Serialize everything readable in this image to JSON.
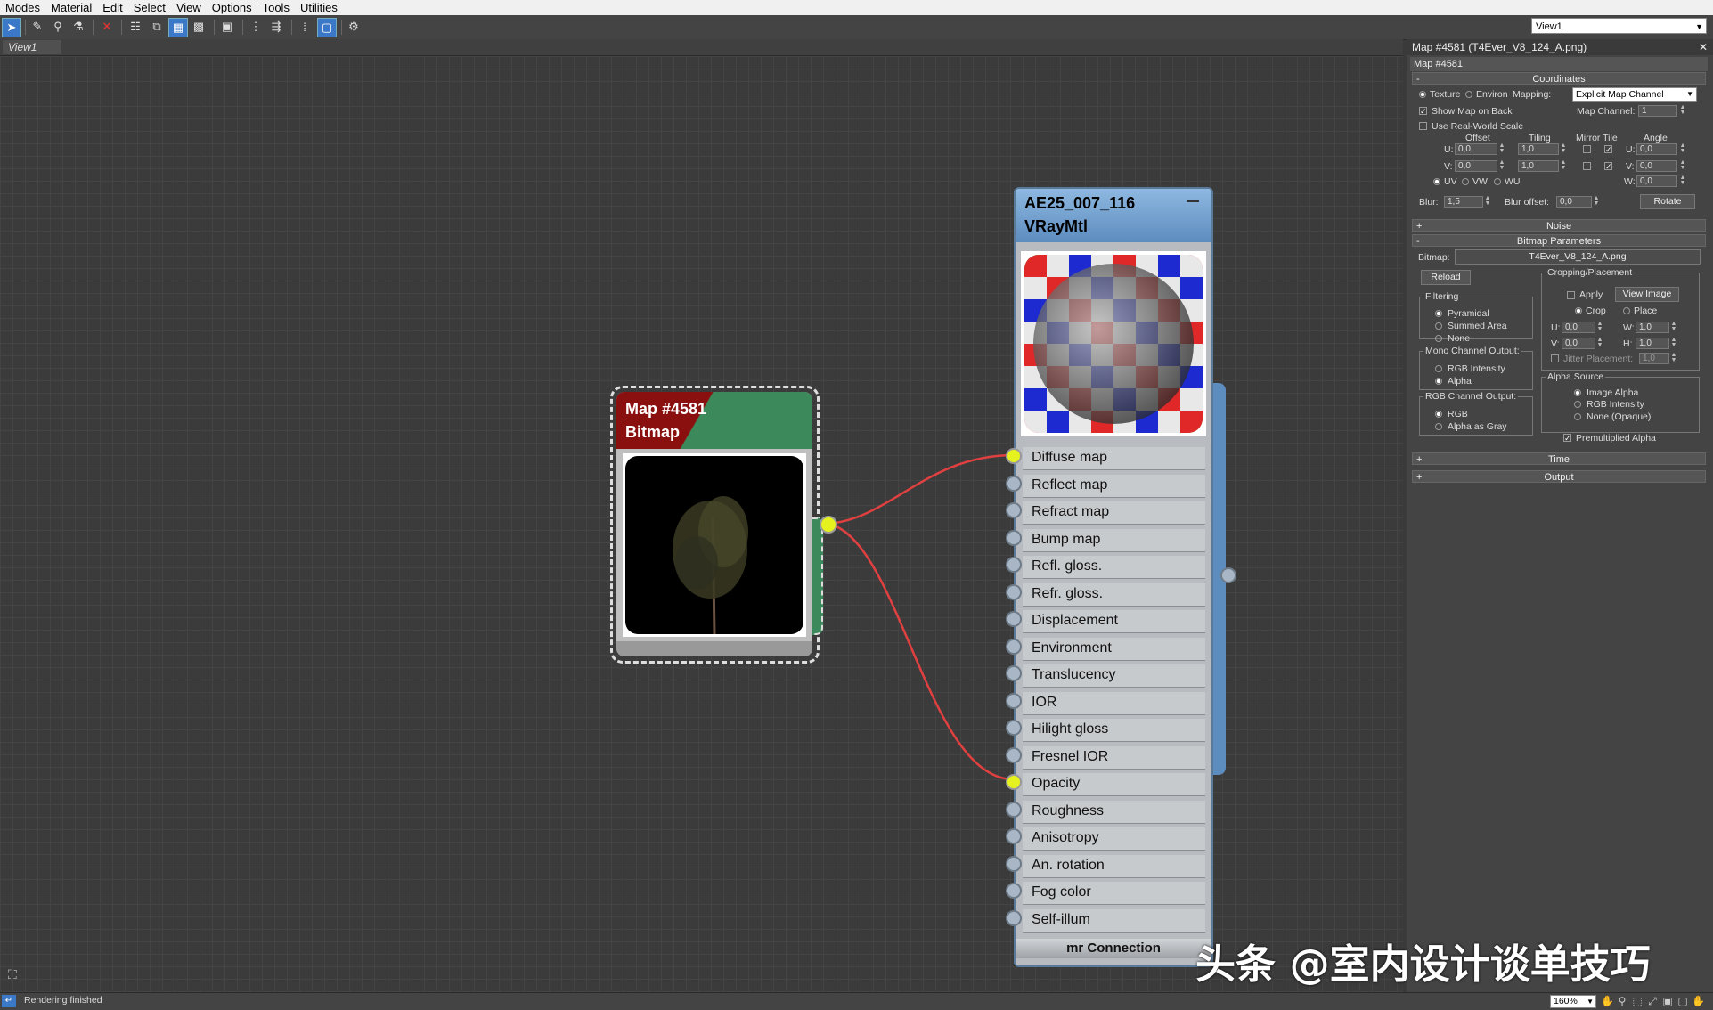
{
  "menubar": {
    "items": [
      "Modes",
      "Material",
      "Edit",
      "Select",
      "View",
      "Options",
      "Tools",
      "Utilities"
    ]
  },
  "toolbar": {
    "icons": [
      "select-arrow-icon",
      "eyedropper-icon",
      "pick-material-icon",
      "put-material-icon",
      "delete-icon",
      "layout-icon",
      "layout-children-icon",
      "show-map-icon",
      "background-icon",
      "render-map-icon",
      "select-by-material-icon",
      "move-children-icon",
      "hide-unused-slots-icon",
      "lock-icon"
    ],
    "view_select": "View1"
  },
  "view_tab": {
    "label": "View1"
  },
  "bitmap_node": {
    "name": "Map #4581",
    "type": "Bitmap"
  },
  "material_node": {
    "name": "AE25_007_116",
    "type": "VRayMtl",
    "slots": [
      {
        "label": "Diffuse map",
        "connected": true
      },
      {
        "label": "Reflect map",
        "connected": false
      },
      {
        "label": "Refract map",
        "connected": false
      },
      {
        "label": "Bump map",
        "connected": false
      },
      {
        "label": "Refl. gloss.",
        "connected": false
      },
      {
        "label": "Refr. gloss.",
        "connected": false
      },
      {
        "label": "Displacement",
        "connected": false
      },
      {
        "label": "Environment",
        "connected": false
      },
      {
        "label": "Translucency",
        "connected": false
      },
      {
        "label": "IOR",
        "connected": false
      },
      {
        "label": "Hilight gloss",
        "connected": false
      },
      {
        "label": "Fresnel IOR",
        "connected": false
      },
      {
        "label": "Opacity",
        "connected": true
      },
      {
        "label": "Roughness",
        "connected": false
      },
      {
        "label": "Anisotropy",
        "connected": false
      },
      {
        "label": "An. rotation",
        "connected": false
      },
      {
        "label": "Fog color",
        "connected": false
      },
      {
        "label": "Self-illum",
        "connected": false
      }
    ],
    "footer": "mr Connection"
  },
  "panel": {
    "title": "Map #4581  (T4Ever_V8_124_A.png)",
    "name_field": "Map #4581",
    "coordinates": {
      "header": "Coordinates",
      "texture": "Texture",
      "environ": "Environ",
      "mapping_label": "Mapping:",
      "mapping_value": "Explicit Map Channel",
      "show_map_on_back": "Show Map on Back",
      "map_channel_label": "Map Channel:",
      "map_channel": "1",
      "use_real_world": "Use Real-World Scale",
      "offset": "Offset",
      "tiling": "Tiling",
      "mirror_tile": "Mirror Tile",
      "angle": "Angle",
      "u": "U:",
      "v": "V:",
      "w": "W:",
      "u_offset": "0,0",
      "v_offset": "0,0",
      "u_tiling": "1,0",
      "v_tiling": "1,0",
      "u_angle": "0,0",
      "v_angle": "0,0",
      "w_angle": "0,0",
      "uv": "UV",
      "vw": "VW",
      "wu": "WU",
      "blur_label": "Blur:",
      "blur": "1,5",
      "blur_offset_label": "Blur offset:",
      "blur_offset": "0,0",
      "rotate": "Rotate"
    },
    "noise": "Noise",
    "bitmap_params": {
      "header": "Bitmap Parameters",
      "bitmap_label": "Bitmap:",
      "bitmap_file": "T4Ever_V8_124_A.png",
      "reload": "Reload",
      "cropping": "Cropping/Placement",
      "apply": "Apply",
      "view_image": "View Image",
      "crop": "Crop",
      "place": "Place",
      "cu_label": "U:",
      "cu": "0,0",
      "cw_label": "W:",
      "cw": "1,0",
      "cv_label": "V:",
      "cv": "0,0",
      "ch_label": "H:",
      "ch": "1,0",
      "jitter": "Jitter Placement:",
      "jitter_val": "1,0",
      "filtering": "Filtering",
      "pyramidal": "Pyramidal",
      "summed": "Summed Area",
      "none": "None",
      "mono": "Mono Channel Output:",
      "rgb_intensity": "RGB Intensity",
      "alpha": "Alpha",
      "rgb_out": "RGB Channel Output:",
      "rgb": "RGB",
      "alpha_gray": "Alpha as Gray",
      "alpha_source": "Alpha Source",
      "image_alpha": "Image Alpha",
      "as_rgb_intensity": "RGB Intensity",
      "none_opaque": "None (Opaque)",
      "premult": "Premultiplied Alpha"
    },
    "time": "Time",
    "output": "Output"
  },
  "status": {
    "message": "Rendering finished",
    "zoom": "160%"
  },
  "watermark": "头条 @室内设计谈单技巧",
  "colors": {
    "wire": "#e04040",
    "socket_on": "#e6f21e",
    "bitmap_header_red": "#8a1010",
    "bitmap_header_green": "#3c8a5c",
    "material_header": "#5d8cbf"
  }
}
